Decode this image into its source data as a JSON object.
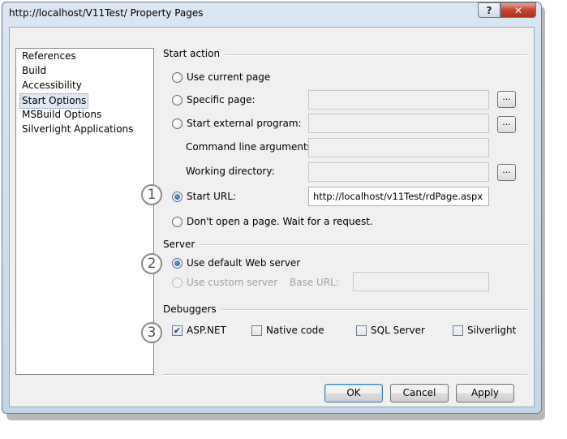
{
  "window": {
    "title": "http://localhost/V11Test/ Property Pages",
    "help_glyph": "?",
    "close_glyph": "✕"
  },
  "nav": {
    "items": [
      {
        "label": "References",
        "selected": false
      },
      {
        "label": "Build",
        "selected": false
      },
      {
        "label": "Accessibility",
        "selected": false
      },
      {
        "label": "Start Options",
        "selected": true
      },
      {
        "label": "MSBuild Options",
        "selected": false
      },
      {
        "label": "Silverlight Applications",
        "selected": false
      }
    ]
  },
  "start_action": {
    "title": "Start action",
    "use_current_page": "Use current page",
    "specific_page": "Specific page:",
    "start_external_program": "Start external program:",
    "command_line_arguments": "Command line arguments:",
    "working_directory": "Working directory:",
    "start_url": "Start URL:",
    "start_url_value": "http://localhost/v11Test/rdPage.aspx",
    "dont_open": "Don't open a page. Wait for a request.",
    "selected": "start_url",
    "browse_label": "..."
  },
  "server": {
    "title": "Server",
    "use_default": "Use default Web server",
    "use_custom": "Use custom server",
    "base_url": "Base URL:",
    "base_url_value": "",
    "selected": "use_default"
  },
  "debuggers": {
    "title": "Debuggers",
    "items": [
      {
        "label": "ASP.NET",
        "checked": true
      },
      {
        "label": "Native code",
        "checked": false
      },
      {
        "label": "SQL Server",
        "checked": false
      },
      {
        "label": "Silverlight",
        "checked": false
      }
    ],
    "check_glyph": "✔"
  },
  "callouts": [
    "1",
    "2",
    "3"
  ],
  "buttons": {
    "ok": "OK",
    "cancel": "Cancel",
    "apply": "Apply"
  }
}
